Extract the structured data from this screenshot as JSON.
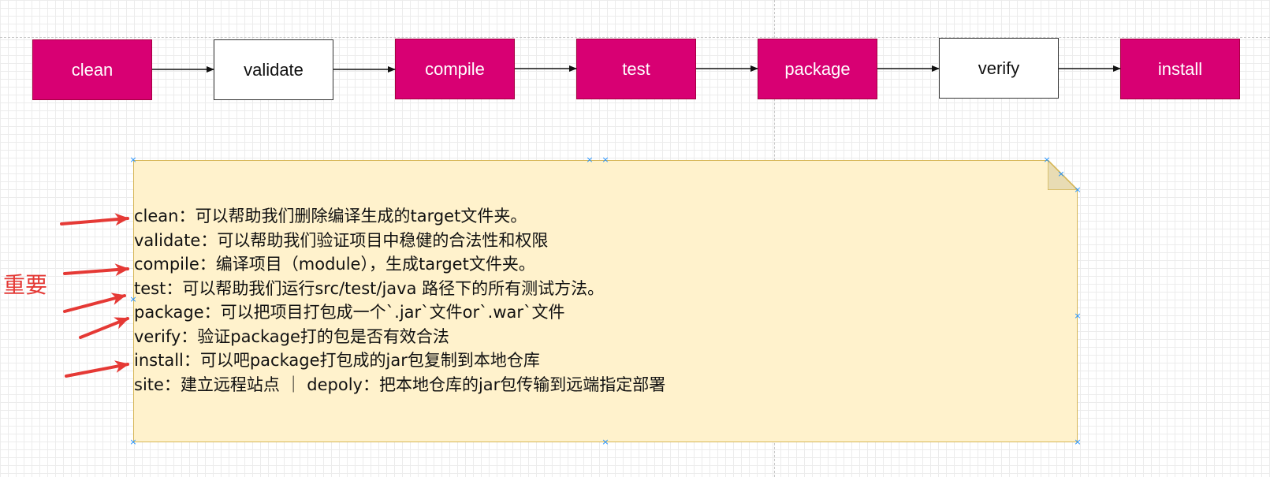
{
  "colors": {
    "accent_fill": "#d80073",
    "note_fill": "#fff2cc",
    "note_border": "#d6b656",
    "annotation_red": "#e53935",
    "handle_blue": "#1e90ff"
  },
  "flow": {
    "nodes": [
      {
        "label": "clean",
        "style": "filled"
      },
      {
        "label": "validate",
        "style": "plain"
      },
      {
        "label": "compile",
        "style": "filled"
      },
      {
        "label": "test",
        "style": "filled"
      },
      {
        "label": "package",
        "style": "filled"
      },
      {
        "label": "verify",
        "style": "plain"
      },
      {
        "label": "install",
        "style": "filled"
      }
    ]
  },
  "note": {
    "lines": [
      "clean：可以帮助我们删除编译生成的target文件夹。",
      "validate：可以帮助我们验证项目中稳健的合法性和权限",
      "compile：编译项目（module），生成target文件夹。",
      "test：可以帮助我们运行src/test/java 路径下的所有测试方法。",
      "package：可以把项目打包成一个`.jar`文件or`.war`文件",
      "verify：验证package打的包是否有效合法",
      "install：可以吧package打包成的jar包复制到本地仓库",
      "site：建立远程站点 ｜ depoly：把本地仓库的jar包传输到远端指定部署"
    ]
  },
  "annotation": {
    "label": "重要"
  },
  "icons": {
    "selection_handle": "×",
    "arrow": "red-arrow-icon"
  }
}
